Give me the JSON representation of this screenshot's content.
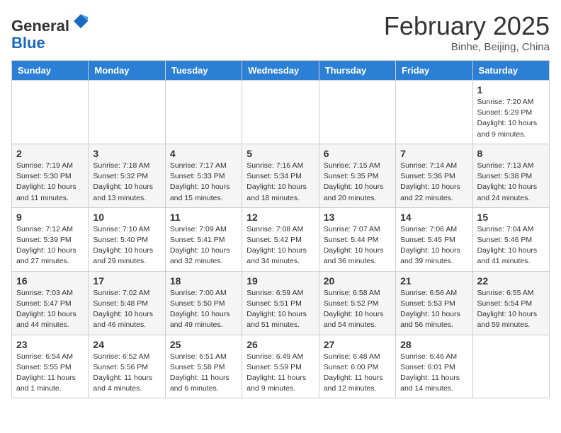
{
  "header": {
    "logo_general": "General",
    "logo_blue": "Blue",
    "month_title": "February 2025",
    "location": "Binhe, Beijing, China"
  },
  "days_of_week": [
    "Sunday",
    "Monday",
    "Tuesday",
    "Wednesday",
    "Thursday",
    "Friday",
    "Saturday"
  ],
  "weeks": [
    [
      {
        "day": "",
        "info": ""
      },
      {
        "day": "",
        "info": ""
      },
      {
        "day": "",
        "info": ""
      },
      {
        "day": "",
        "info": ""
      },
      {
        "day": "",
        "info": ""
      },
      {
        "day": "",
        "info": ""
      },
      {
        "day": "1",
        "info": "Sunrise: 7:20 AM\nSunset: 5:29 PM\nDaylight: 10 hours and 9 minutes."
      }
    ],
    [
      {
        "day": "2",
        "info": "Sunrise: 7:19 AM\nSunset: 5:30 PM\nDaylight: 10 hours and 11 minutes."
      },
      {
        "day": "3",
        "info": "Sunrise: 7:18 AM\nSunset: 5:32 PM\nDaylight: 10 hours and 13 minutes."
      },
      {
        "day": "4",
        "info": "Sunrise: 7:17 AM\nSunset: 5:33 PM\nDaylight: 10 hours and 15 minutes."
      },
      {
        "day": "5",
        "info": "Sunrise: 7:16 AM\nSunset: 5:34 PM\nDaylight: 10 hours and 18 minutes."
      },
      {
        "day": "6",
        "info": "Sunrise: 7:15 AM\nSunset: 5:35 PM\nDaylight: 10 hours and 20 minutes."
      },
      {
        "day": "7",
        "info": "Sunrise: 7:14 AM\nSunset: 5:36 PM\nDaylight: 10 hours and 22 minutes."
      },
      {
        "day": "8",
        "info": "Sunrise: 7:13 AM\nSunset: 5:38 PM\nDaylight: 10 hours and 24 minutes."
      }
    ],
    [
      {
        "day": "9",
        "info": "Sunrise: 7:12 AM\nSunset: 5:39 PM\nDaylight: 10 hours and 27 minutes."
      },
      {
        "day": "10",
        "info": "Sunrise: 7:10 AM\nSunset: 5:40 PM\nDaylight: 10 hours and 29 minutes."
      },
      {
        "day": "11",
        "info": "Sunrise: 7:09 AM\nSunset: 5:41 PM\nDaylight: 10 hours and 32 minutes."
      },
      {
        "day": "12",
        "info": "Sunrise: 7:08 AM\nSunset: 5:42 PM\nDaylight: 10 hours and 34 minutes."
      },
      {
        "day": "13",
        "info": "Sunrise: 7:07 AM\nSunset: 5:44 PM\nDaylight: 10 hours and 36 minutes."
      },
      {
        "day": "14",
        "info": "Sunrise: 7:06 AM\nSunset: 5:45 PM\nDaylight: 10 hours and 39 minutes."
      },
      {
        "day": "15",
        "info": "Sunrise: 7:04 AM\nSunset: 5:46 PM\nDaylight: 10 hours and 41 minutes."
      }
    ],
    [
      {
        "day": "16",
        "info": "Sunrise: 7:03 AM\nSunset: 5:47 PM\nDaylight: 10 hours and 44 minutes."
      },
      {
        "day": "17",
        "info": "Sunrise: 7:02 AM\nSunset: 5:48 PM\nDaylight: 10 hours and 46 minutes."
      },
      {
        "day": "18",
        "info": "Sunrise: 7:00 AM\nSunset: 5:50 PM\nDaylight: 10 hours and 49 minutes."
      },
      {
        "day": "19",
        "info": "Sunrise: 6:59 AM\nSunset: 5:51 PM\nDaylight: 10 hours and 51 minutes."
      },
      {
        "day": "20",
        "info": "Sunrise: 6:58 AM\nSunset: 5:52 PM\nDaylight: 10 hours and 54 minutes."
      },
      {
        "day": "21",
        "info": "Sunrise: 6:56 AM\nSunset: 5:53 PM\nDaylight: 10 hours and 56 minutes."
      },
      {
        "day": "22",
        "info": "Sunrise: 6:55 AM\nSunset: 5:54 PM\nDaylight: 10 hours and 59 minutes."
      }
    ],
    [
      {
        "day": "23",
        "info": "Sunrise: 6:54 AM\nSunset: 5:55 PM\nDaylight: 11 hours and 1 minute."
      },
      {
        "day": "24",
        "info": "Sunrise: 6:52 AM\nSunset: 5:56 PM\nDaylight: 11 hours and 4 minutes."
      },
      {
        "day": "25",
        "info": "Sunrise: 6:51 AM\nSunset: 5:58 PM\nDaylight: 11 hours and 6 minutes."
      },
      {
        "day": "26",
        "info": "Sunrise: 6:49 AM\nSunset: 5:59 PM\nDaylight: 11 hours and 9 minutes."
      },
      {
        "day": "27",
        "info": "Sunrise: 6:48 AM\nSunset: 6:00 PM\nDaylight: 11 hours and 12 minutes."
      },
      {
        "day": "28",
        "info": "Sunrise: 6:46 AM\nSunset: 6:01 PM\nDaylight: 11 hours and 14 minutes."
      },
      {
        "day": "",
        "info": ""
      }
    ]
  ]
}
